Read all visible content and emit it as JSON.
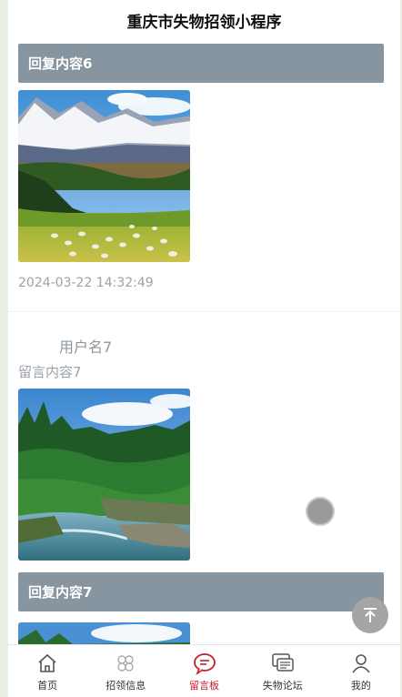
{
  "header": {
    "title": "重庆市失物招领小程序"
  },
  "thread": {
    "reply_6": "回复内容6",
    "timestamp": "2024-03-22 14:32:49",
    "user": "用户名7",
    "message": "留言内容7",
    "reply_7": "回复内容7"
  },
  "tabs": [
    {
      "label": "首页",
      "icon": "home-icon"
    },
    {
      "label": "招领信息",
      "icon": "clover-icon"
    },
    {
      "label": "留言板",
      "icon": "chat-bubble-icon",
      "active": true
    },
    {
      "label": "失物论坛",
      "icon": "forum-icon"
    },
    {
      "label": "我的",
      "icon": "user-icon"
    }
  ],
  "colors": {
    "accent": "#c0212a",
    "reply_bar": "#86959f"
  }
}
